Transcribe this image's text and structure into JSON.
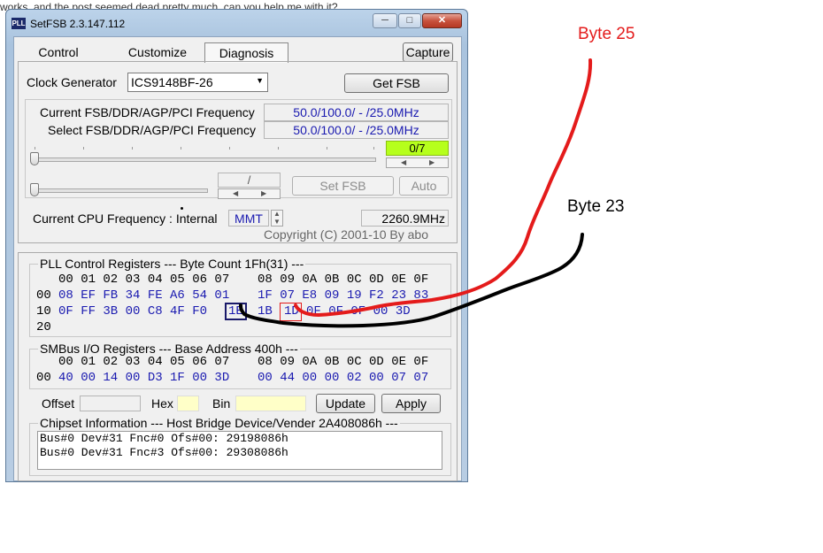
{
  "background": {
    "top_text": "works, and the post seemed dead pretty much, can you help me with it?"
  },
  "window": {
    "title": "SetFSB 2.3.147.112",
    "icon_label": "PLL",
    "caption_buttons": {
      "minimize": "─",
      "maximize": "□",
      "close": "✕"
    },
    "tabs": [
      "Control",
      "Customize",
      "Diagnosis"
    ],
    "active_tab": "Diagnosis",
    "capture_label": "Capture"
  },
  "clock": {
    "label": "Clock Generator",
    "selected": "ICS9148BF-26",
    "get_fsb_label": "Get FSB",
    "current_label": "Current FSB/DDR/AGP/PCI Frequency",
    "current_value": "50.0/100.0/ - /25.0MHz",
    "select_label": "Select FSB/DDR/AGP/PCI Frequency",
    "select_value": "50.0/100.0/ - /25.0MHz",
    "slider_counter": "0/7",
    "slider_position": 0,
    "slider2_value": "/",
    "set_fsb_label": "Set FSB",
    "auto_label": "Auto",
    "cpu_label": "Current CPU Frequency : Internal",
    "cpu_source": "MMT",
    "cpu_value": "2260.9MHz",
    "copyright": "Copyright (C) 2001-10 By abo"
  },
  "pll": {
    "title": "PLL Control Registers  --- Byte Count 1Fh(31) ---",
    "header_a": "00 01 02 03 04 05 06 07",
    "header_b": "08 09 0A 0B 0C 0D 0E 0F",
    "rows": [
      {
        "addr": "00",
        "a": "08 EF FB 34 FE A6 54 01",
        "b": "1F 07 E8 09 19 F2 23 83"
      },
      {
        "addr": "10",
        "a": "0F FF 3B 00 C8 4F F0",
        "a_last": "1E",
        "b_first": "1B",
        "b_hl": "1D",
        "b": "0F 0F 0F 00 3D"
      },
      {
        "addr": "20",
        "a": "",
        "b": ""
      }
    ]
  },
  "smbus": {
    "title": "SMBus I/O Registers  --- Base Address 400h ---",
    "header_a": "00 01 02 03 04 05 06 07",
    "header_b": "08 09 0A 0B 0C 0D 0E 0F",
    "addr": "00",
    "a": "40 00 14 00 D3 1F 00 3D",
    "b": "00 44 00 00 02 00 07 07"
  },
  "edit": {
    "offset_label": "Offset",
    "hex_label": "Hex",
    "bin_label": "Bin",
    "update_label": "Update",
    "apply_label": "Apply"
  },
  "chipset": {
    "title": "Chipset Information  --- Host Bridge Device/Vender 2A408086h ---",
    "lines": [
      "Bus#0 Dev#31 Fnc#0 Ofs#00: 29198086h",
      "Bus#0 Dev#31 Fnc#3 Ofs#00: 29308086h"
    ]
  },
  "annotations": {
    "byte25": "Byte 25",
    "byte23": "Byte 23",
    "byte25_color": "#e41b1b",
    "byte23_color": "#000000"
  }
}
